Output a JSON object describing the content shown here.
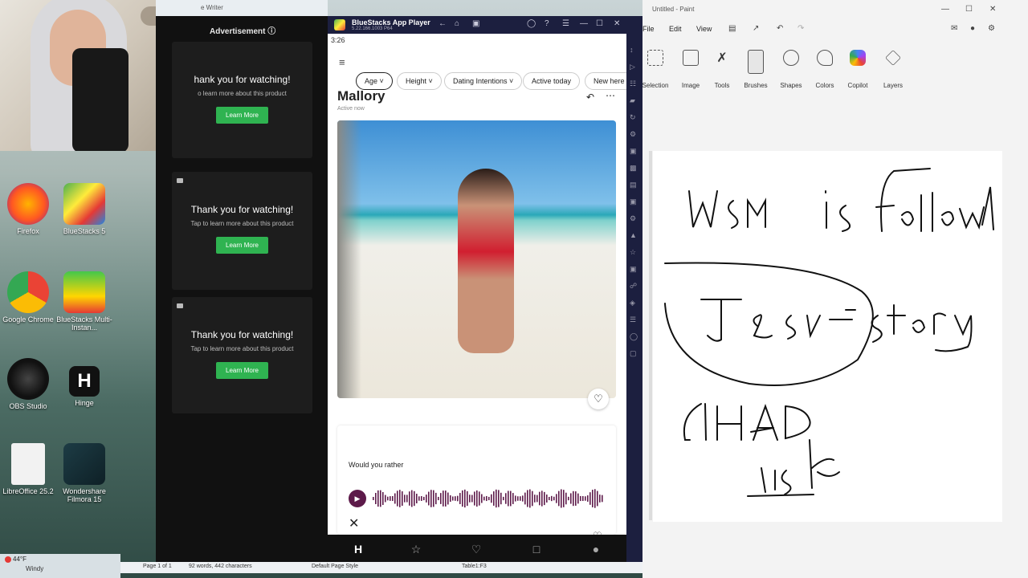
{
  "webcam": {
    "label": "webcam-overlay"
  },
  "desktop": {
    "icons": [
      {
        "label": "Firefox"
      },
      {
        "label": "BlueStacks 5"
      },
      {
        "label": "Google Chrome"
      },
      {
        "label": "BlueStacks Multi-Instan..."
      },
      {
        "label": "OBS Studio"
      },
      {
        "label": "Hinge"
      },
      {
        "label": "LibreOffice 25.2"
      },
      {
        "label": "Wondershare Filmora 15"
      }
    ],
    "weather": {
      "temp": "44°F",
      "cond": "Windy"
    }
  },
  "writer": {
    "title": "e Writer",
    "ad_header": "Advertisement",
    "ads": [
      {
        "title": "hank you for watching!",
        "sub": "o learn more about this product",
        "button": "Learn More"
      },
      {
        "title": "Thank you for watching!",
        "sub": "Tap to learn more about this product",
        "button": "Learn More"
      },
      {
        "title": "Thank you for watching!",
        "sub": "Tap to learn more about this product",
        "button": "Learn More"
      }
    ],
    "status": {
      "page": "Page 1 of 1",
      "words": "92 words, 442 characters",
      "style": "Default Page Style",
      "table": "Table1:F3"
    }
  },
  "bluestacks": {
    "title": "BlueStacks App Player",
    "version": "5.22.166.1003 P64",
    "time": "3:26",
    "filters": [
      "Age",
      "Height",
      "Dating Intentions",
      "Active today",
      "New here"
    ],
    "profile": {
      "name": "Mallory",
      "status": "Active now"
    },
    "prompt": {
      "text": "Would you rather"
    }
  },
  "paint": {
    "title": "Untitled - Paint",
    "menu": [
      "File",
      "Edit",
      "View"
    ],
    "ribbon": [
      "Selection",
      "Image",
      "Tools",
      "Brushes",
      "Shapes",
      "Colors",
      "Copilot",
      "Layers"
    ]
  }
}
